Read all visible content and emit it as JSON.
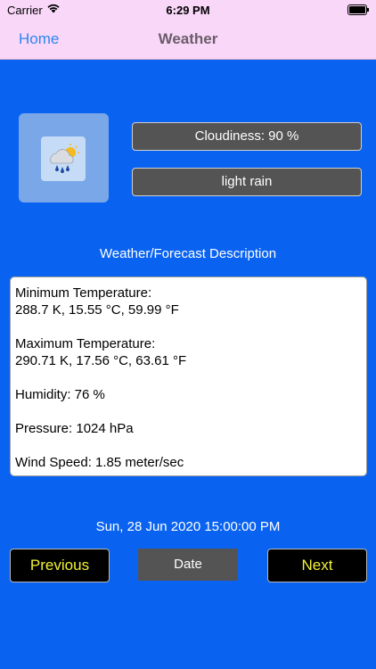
{
  "status_bar": {
    "carrier": "Carrier",
    "time": "6:29 PM"
  },
  "nav": {
    "back_label": "Home",
    "title": "Weather"
  },
  "weather": {
    "icon": "light-rain-sun-icon",
    "cloudiness": "Cloudiness: 90 %",
    "description": "light rain"
  },
  "section_label": "Weather/Forecast Description",
  "details": {
    "min_temp_label": "Minimum Temperature:",
    "min_temp_value": "288.7 K, 15.55 °C, 59.99 °F",
    "max_temp_label": "Maximum Temperature:",
    "max_temp_value": "290.71 K, 17.56 °C, 63.61 °F",
    "humidity": "Humidity: 76 %",
    "pressure": "Pressure: 1024 hPa",
    "wind_speed": "Wind Speed: 1.85 meter/sec"
  },
  "timestamp": "Sun, 28 Jun 2020 15:00:00 PM",
  "buttons": {
    "previous": "Previous",
    "date": "Date",
    "next": "Next"
  },
  "colors": {
    "background": "#0a63f0",
    "nav_bar": "#f9d7f8",
    "accent_yellow": "#f2f236",
    "pill_gray": "#545454"
  }
}
